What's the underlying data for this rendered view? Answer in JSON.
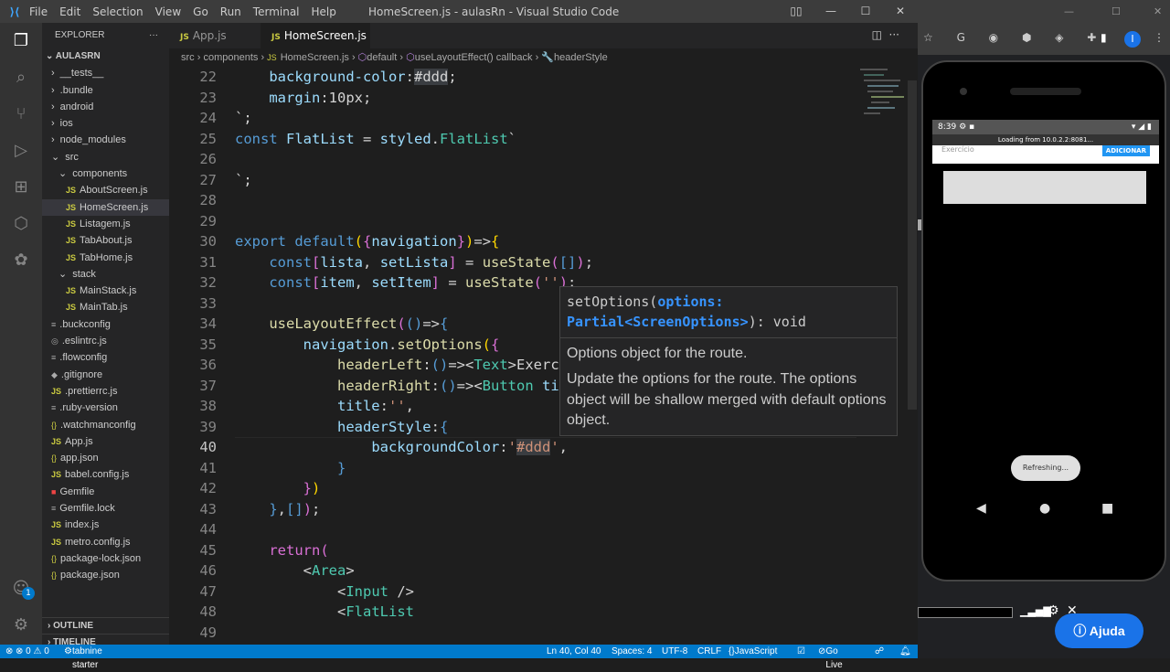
{
  "titlebar": {
    "menu": [
      "File",
      "Edit",
      "Selection",
      "View",
      "Go",
      "Run",
      "Terminal",
      "Help"
    ],
    "title": "HomeScreen.js - aulasRn - Visual Studio Code"
  },
  "explorer": {
    "header": "EXPLORER",
    "root": "AULASRN",
    "items": [
      {
        "label": "__tests__",
        "icon": "chevron-right",
        "indent": 0
      },
      {
        "label": ".bundle",
        "icon": "chevron-right",
        "indent": 0
      },
      {
        "label": "android",
        "icon": "chevron-right",
        "indent": 0
      },
      {
        "label": "ios",
        "icon": "chevron-right",
        "indent": 0
      },
      {
        "label": "node_modules",
        "icon": "chevron-right",
        "indent": 0
      },
      {
        "label": "src",
        "icon": "chevron-down",
        "indent": 0
      },
      {
        "label": "components",
        "icon": "chevron-down",
        "indent": 1
      },
      {
        "label": "AboutScreen.js",
        "icon": "JS",
        "indent": 2
      },
      {
        "label": "HomeScreen.js",
        "icon": "JS",
        "indent": 2,
        "selected": true
      },
      {
        "label": "Listagem.js",
        "icon": "JS",
        "indent": 2
      },
      {
        "label": "TabAbout.js",
        "icon": "JS",
        "indent": 2
      },
      {
        "label": "TabHome.js",
        "icon": "JS",
        "indent": 2
      },
      {
        "label": "stack",
        "icon": "chevron-down",
        "indent": 1
      },
      {
        "label": "MainStack.js",
        "icon": "JS",
        "indent": 2
      },
      {
        "label": "MainTab.js",
        "icon": "JS",
        "indent": 2
      },
      {
        "label": ".buckconfig",
        "icon": "≡",
        "indent": 0
      },
      {
        "label": ".eslintrc.js",
        "icon": "◎",
        "indent": 0
      },
      {
        "label": ".flowconfig",
        "icon": "≡",
        "indent": 0
      },
      {
        "label": ".gitignore",
        "icon": "◆",
        "indent": 0
      },
      {
        "label": ".prettierrc.js",
        "icon": "JS",
        "indent": 0
      },
      {
        "label": ".ruby-version",
        "icon": "≡",
        "indent": 0
      },
      {
        "label": ".watchmanconfig",
        "icon": "{}",
        "indent": 0
      },
      {
        "label": "App.js",
        "icon": "JS",
        "indent": 0
      },
      {
        "label": "app.json",
        "icon": "{}",
        "indent": 0
      },
      {
        "label": "babel.config.js",
        "icon": "JS",
        "indent": 0
      },
      {
        "label": "Gemfile",
        "icon": "■",
        "indent": 0
      },
      {
        "label": "Gemfile.lock",
        "icon": "≡",
        "indent": 0
      },
      {
        "label": "index.js",
        "icon": "JS",
        "indent": 0
      },
      {
        "label": "metro.config.js",
        "icon": "JS",
        "indent": 0
      },
      {
        "label": "package-lock.json",
        "icon": "{}",
        "indent": 0
      },
      {
        "label": "package.json",
        "icon": "{}",
        "indent": 0
      }
    ],
    "outline": "OUTLINE",
    "timeline": "TIMELINE"
  },
  "tabs": [
    {
      "label": "App.js",
      "active": false
    },
    {
      "label": "HomeScreen.js",
      "active": true
    }
  ],
  "breadcrumb": [
    "src",
    "components",
    "HomeScreen.js",
    "default",
    "useLayoutEffect() callback",
    "headerStyle"
  ],
  "code": [
    {
      "n": "22",
      "h": "    <span class=\"v\">background-color</span>:<span class=\"hl\">#ddd</span>;"
    },
    {
      "n": "23",
      "h": "    <span class=\"v\">margin</span>:10px;"
    },
    {
      "n": "24",
      "h": "`;"
    },
    {
      "n": "25",
      "h": "<span class=\"k\">const</span> <span class=\"v\">FlatList</span> = <span class=\"v\">styled</span>.<span class=\"c\">FlatList</span>`"
    },
    {
      "n": "26",
      "h": ""
    },
    {
      "n": "27",
      "h": "`;"
    },
    {
      "n": "28",
      "h": ""
    },
    {
      "n": "29",
      "h": ""
    },
    {
      "n": "30",
      "h": "<span class=\"k\">export</span> <span class=\"k\">default</span><span class=\"y\">(</span><span class=\"p\">{</span><span class=\"v\">navigation</span><span class=\"p\">}</span><span class=\"y\">)</span>=&gt;<span class=\"y\">{</span>"
    },
    {
      "n": "31",
      "h": "    <span class=\"k\">const</span><span class=\"p\">[</span><span class=\"v\">lista</span>, <span class=\"v\">setLista</span><span class=\"p\">]</span> = <span class=\"f\">useState</span><span class=\"p\">(</span><span class=\"k\">[]</span><span class=\"p\">)</span>;"
    },
    {
      "n": "32",
      "h": "    <span class=\"k\">const</span><span class=\"p\">[</span><span class=\"v\">item</span>, <span class=\"v\">setItem</span><span class=\"p\">]</span> = <span class=\"f\">useState</span><span class=\"p\">(</span><span class=\"s\">''</span><span class=\"p\">)</span>;"
    },
    {
      "n": "33",
      "h": ""
    },
    {
      "n": "34",
      "h": "    <span class=\"f\">useLayoutEffect</span><span class=\"p\">(</span><span class=\"k\">()</span>=&gt;<span class=\"k\">{</span>"
    },
    {
      "n": "35",
      "h": "        <span class=\"v\">navigation</span>.<span class=\"f\">setOptions</span><span class=\"y\">(</span><span class=\"p\">{</span>"
    },
    {
      "n": "36",
      "h": "            <span class=\"f\">headerLeft</span>:<span class=\"k\">()</span>=&gt;&lt;<span class=\"c\">Text</span>&gt;Exercício"
    },
    {
      "n": "37",
      "h": "            <span class=\"f\">headerRight</span>:<span class=\"k\">()</span>=&gt;&lt;<span class=\"c\">Button</span> <span class=\"v\">title</span>"
    },
    {
      "n": "38",
      "h": "            <span class=\"v\">title</span>:<span class=\"s\">''</span>,"
    },
    {
      "n": "39",
      "h": "            <span class=\"v\">headerStyle</span>:<span class=\"k\">{</span>"
    },
    {
      "n": "40",
      "h": "                <span class=\"v\">backgroundColor</span>:<span class=\"s\">'<span class=\"hl\">#ddd</span>'</span>,",
      "cur": true
    },
    {
      "n": "41",
      "h": "            <span class=\"k\">}</span>"
    },
    {
      "n": "42",
      "h": "        <span class=\"p\">}</span><span class=\"y\">)</span>"
    },
    {
      "n": "43",
      "h": "    <span class=\"k\">}</span>,<span class=\"k\">[]</span><span class=\"p\">)</span>;"
    },
    {
      "n": "44",
      "h": ""
    },
    {
      "n": "45",
      "h": "    <span class=\"p\">return</span><span class=\"p\">(</span>"
    },
    {
      "n": "46",
      "h": "        &lt;<span class=\"c\">Area</span>&gt;"
    },
    {
      "n": "47",
      "h": "            &lt;<span class=\"c\">Input</span> /&gt;"
    },
    {
      "n": "48",
      "h": "            &lt;<span class=\"c\">FlatList</span>"
    },
    {
      "n": "49",
      "h": ""
    }
  ],
  "tooltip": {
    "sig_name": "setOptions(",
    "sig_param": "options:",
    "sig_type": "Partial<ScreenOptions>",
    "sig_ret": "): void",
    "desc1": "Options object for the route.",
    "desc2": "Update the options for the route. The options object will be shallow merged with default options object."
  },
  "statusbar": {
    "errors": "⊗ 0 ⚠ 0",
    "tabnine": "tabnine starter",
    "position": "Ln 40, Col 40",
    "spaces": "Spaces: 4",
    "encoding": "UTF-8",
    "eol": "CRLF",
    "language": "JavaScript",
    "golive": "Go Live"
  },
  "browser": {
    "profile": "I"
  },
  "phone": {
    "time": "8:39",
    "loading": "Loading from 10.0.2.2:8081...",
    "input_placeholder": "Exercício",
    "add_button": "ADICIONAR",
    "refreshing": "Refreshing..."
  },
  "help_button": "Ajuda"
}
